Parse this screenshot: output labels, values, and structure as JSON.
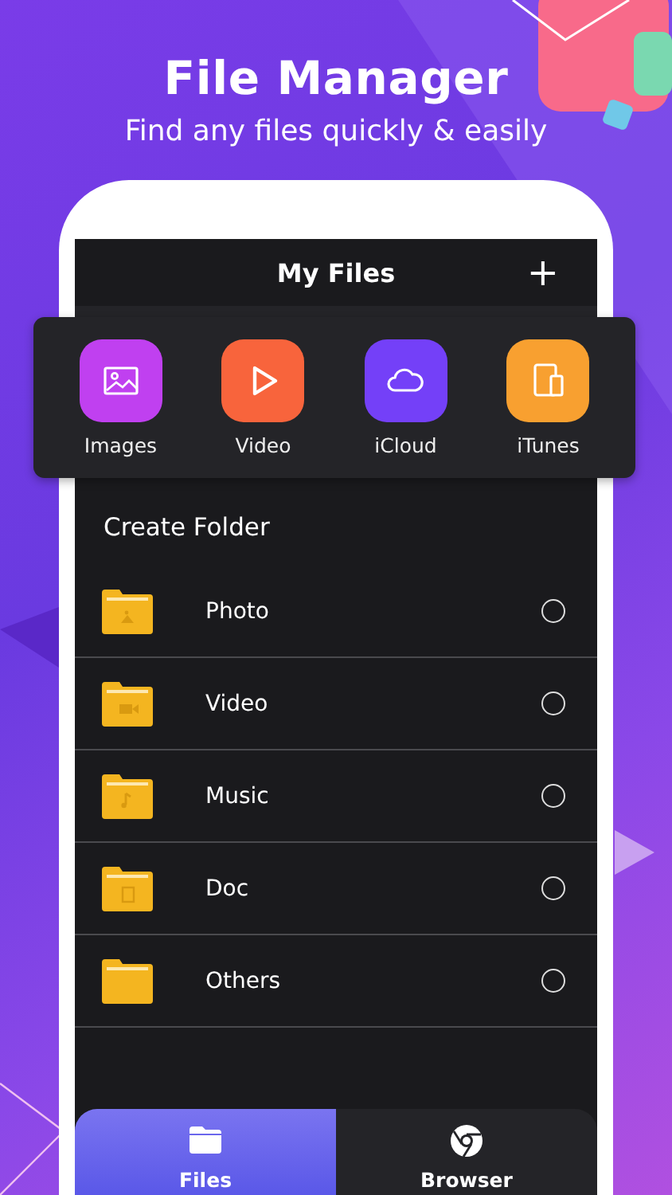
{
  "headline": "File Manager",
  "tagline": "Find any files quickly & easily",
  "screen": {
    "title": "My Files",
    "add_button": "+",
    "shortcuts": [
      {
        "label": "Images",
        "kind": "image",
        "color": "#c040f0"
      },
      {
        "label": "Video",
        "kind": "play",
        "color": "#f8643c"
      },
      {
        "label": "iCloud",
        "kind": "cloud",
        "color": "#7440f8"
      },
      {
        "label": "iTunes",
        "kind": "devices",
        "color": "#f8a030"
      }
    ],
    "section_title": "Create Folder",
    "folders": [
      {
        "name": "Photo",
        "kind": "image",
        "selected": false
      },
      {
        "name": "Video",
        "kind": "video",
        "selected": false
      },
      {
        "name": "Music",
        "kind": "music",
        "selected": false
      },
      {
        "name": "Doc",
        "kind": "doc",
        "selected": false
      },
      {
        "name": "Others",
        "kind": "plain",
        "selected": false
      }
    ],
    "tabs": [
      {
        "label": "Files",
        "kind": "folder",
        "selected": true
      },
      {
        "label": "Browser",
        "kind": "browser",
        "selected": false
      }
    ]
  }
}
